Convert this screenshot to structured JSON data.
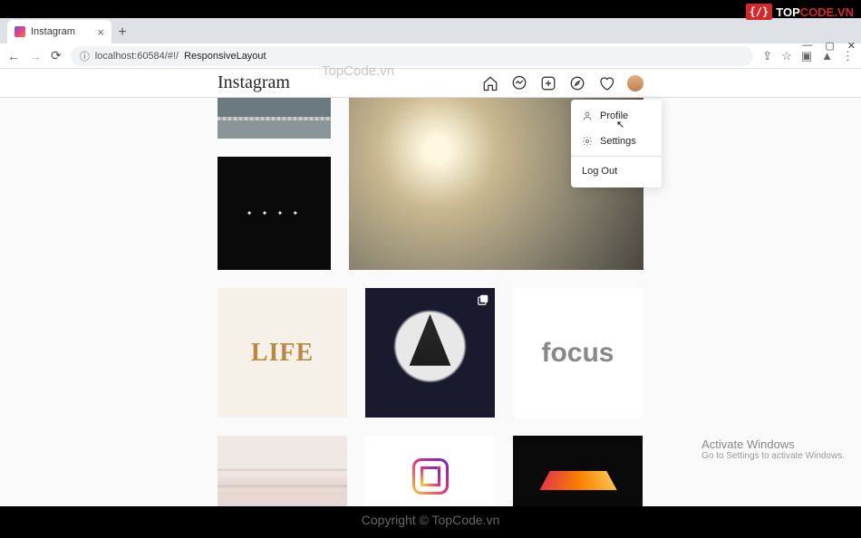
{
  "browser": {
    "tab_title": "Instagram",
    "url_prefix": "localhost:60584/#!/",
    "url_path": "ResponsiveLayout",
    "new_tab": "+",
    "tab_close": "×",
    "nav_back": "←",
    "nav_fwd": "→",
    "nav_reload": "⟳",
    "lock": "ⓘ",
    "win_min": "—",
    "win_max": "▢",
    "win_close": "✕"
  },
  "header": {
    "logo": "Instagram"
  },
  "dropdown": {
    "profile": "Profile",
    "settings": "Settings",
    "logout": "Log Out"
  },
  "tiles": {
    "life": "LIFE",
    "focus": "focus"
  },
  "watermarks": {
    "topcode_badge": "{/}",
    "topcode_a": "TOP",
    "topcode_b": "CODE.VN",
    "center": "TopCode.vn",
    "copyright": "Copyright © TopCode.vn",
    "activate1": "Activate Windows",
    "activate2": "Go to Settings to activate Windows."
  }
}
